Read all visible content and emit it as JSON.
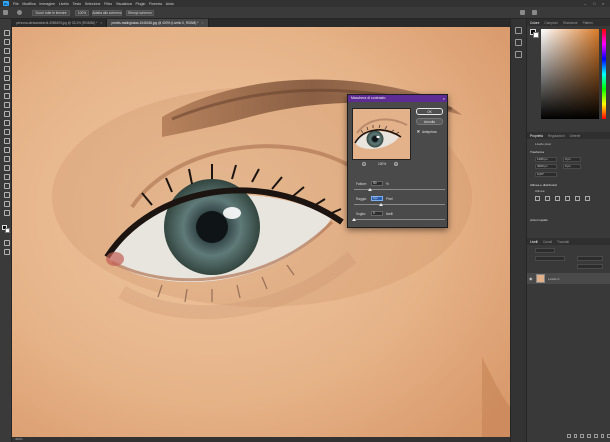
{
  "menubar": {
    "items": [
      "File",
      "Modifica",
      "Immagine",
      "Livello",
      "Testo",
      "Selezione",
      "Filtro",
      "Visualizza",
      "Plugin",
      "Finestra",
      "Aiuto"
    ]
  },
  "optionsbar": {
    "scroll_all_label": "Scorri tutte le finestre",
    "zoom_100_label": "100%",
    "fit_screen_label": "Adatta allo schermo",
    "fill_screen_label": "Riempi schermo"
  },
  "tabs": [
    {
      "label": "persona-alessandrachi-4985493.jpg @ 33,3% (RGB/8#) *"
    },
    {
      "label": "pexels-malinglukas-1046246.jpg @ 400% (Livello 0, RGB/8) *"
    }
  ],
  "status": {
    "text": "400%"
  },
  "dialog": {
    "title": "Maschera di contrasto",
    "ok_label": "OK",
    "reset_label": "Annulla",
    "preview_label": "Anteprima",
    "preview_checked": true,
    "zoom_label": "100%",
    "amount_label": "Fattore:",
    "amount_value": "90",
    "amount_unit": "%",
    "radius_label": "Raggio:",
    "radius_value": "4,0",
    "radius_unit": "Pixel",
    "threshold_label": "Soglia:",
    "threshold_value": "0",
    "threshold_unit": "livelli",
    "amount_level": 0.18,
    "radius_level": 0.3,
    "threshold_level": 0.0
  },
  "panels": {
    "color_tabs": [
      "Colore",
      "Campioni",
      "Sfumature",
      "Pattern"
    ],
    "color_accent": "#d97b2a",
    "properties_tabs": [
      "Proprietà",
      "Regolazioni",
      "Librerie"
    ],
    "properties_kind": "Livello pixel",
    "transform_label": "Trasforma",
    "w_value": "1280 px",
    "h_value": "4000 px",
    "x_value": "0 px",
    "y_value": "0 px",
    "angle_value": "0,00°",
    "align_label": "Allinea e distribuisci",
    "align_sub": "Allinea:",
    "quick_actions_label": "Azioni rapide",
    "layers_tabs": [
      "Livelli",
      "Canali",
      "Tracciati"
    ],
    "layer_name": "Livello 0"
  }
}
